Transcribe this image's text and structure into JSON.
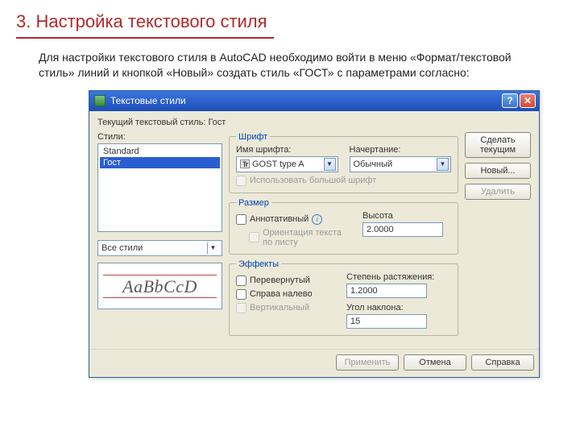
{
  "slide": {
    "title": "3. Настройка текстового стиля",
    "intro": "Для настройки текстового стиля в AutoCAD необходимо войти в меню «Формат/текстовой стиль» линий и кнопкой «Новый» создать стиль «ГОСТ» с параметрами согласно:"
  },
  "dialog": {
    "title": "Текстовые стили",
    "current_style_label": "Текущий текстовый стиль:",
    "current_style_value": "Гост",
    "styles_label": "Стили:",
    "styles": {
      "items": [
        "Standard",
        "Гост"
      ],
      "selected_index": 1
    },
    "filter": "Все стили",
    "preview": "AaBbCcD",
    "font_group": {
      "legend": "Шрифт",
      "name_label": "Имя шрифта:",
      "name_value": "GOST type A",
      "style_label": "Начертание:",
      "style_value": "Обычный",
      "big_font_label": "Использовать большой шрифт"
    },
    "size_group": {
      "legend": "Размер",
      "annotative_label": "Аннотативный",
      "orient_label": "Ориентация текста по листу",
      "height_label": "Высота",
      "height_value": "2.0000"
    },
    "effects_group": {
      "legend": "Эффекты",
      "flip_label": "Перевернутый",
      "rtl_label": "Справа налево",
      "vertical_label": "Вертикальный",
      "width_label": "Степень растяжения:",
      "width_value": "1.2000",
      "angle_label": "Угол наклона:",
      "angle_value": "15"
    },
    "buttons": {
      "set_current": "Сделать текущим",
      "new": "Новый...",
      "delete": "Удалить",
      "apply": "Применить",
      "cancel": "Отмена",
      "help": "Справка"
    }
  }
}
